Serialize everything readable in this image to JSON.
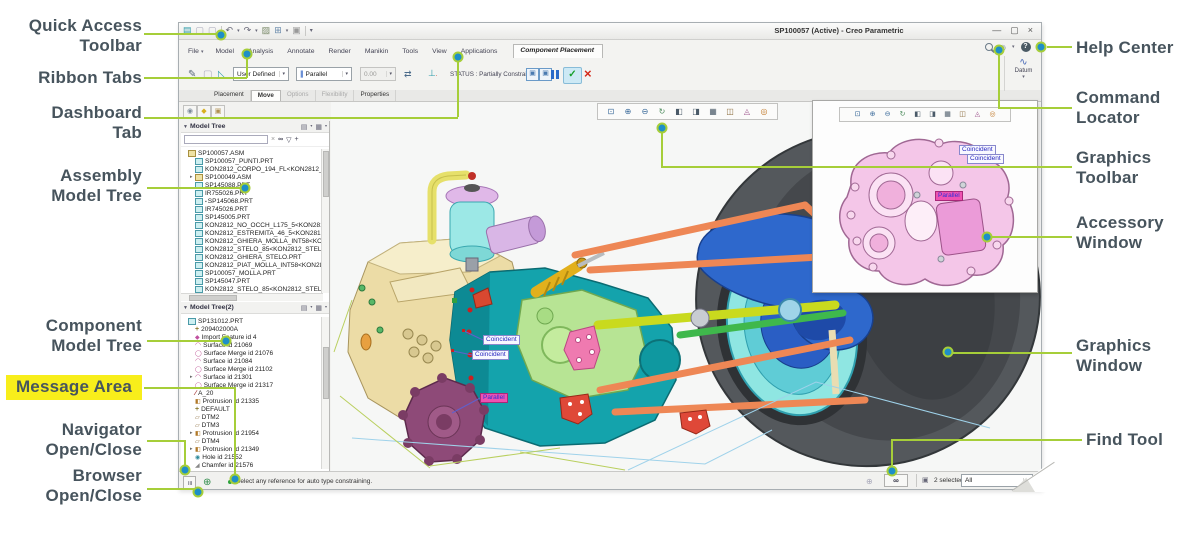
{
  "callouts": {
    "left": [
      {
        "label": "Quick Access\nToolbar"
      },
      {
        "label": "Ribbon Tabs"
      },
      {
        "label": "Dashboard\nTab"
      },
      {
        "label": "Assembly\nModel Tree"
      },
      {
        "label": "Component\nModel Tree"
      },
      {
        "label": "Message Area"
      },
      {
        "label": "Navigator\nOpen/Close"
      },
      {
        "label": "Browser\nOpen/Close"
      }
    ],
    "right": [
      {
        "label": "Help Center"
      },
      {
        "label": "Command\nLocator"
      },
      {
        "label": "Graphics\nToolbar"
      },
      {
        "label": "Accessory\nWindow"
      },
      {
        "label": "Graphics\nWindow"
      },
      {
        "label": "Find Tool"
      }
    ],
    "colors": {
      "line": "#a6ce39",
      "dot": "#1e8fc8",
      "text": "#47545d",
      "highlight": "#f8ee1b"
    }
  },
  "titlebar": {
    "title": "SP100057 (Active) - Creo Parametric"
  },
  "ribbon": {
    "tabs": [
      {
        "label": "File",
        "caret": "▾"
      },
      {
        "label": "Model"
      },
      {
        "label": "Analysis"
      },
      {
        "label": "Annotate"
      },
      {
        "label": "Render"
      },
      {
        "label": "Manikin"
      },
      {
        "label": "Tools"
      },
      {
        "label": "View"
      },
      {
        "label": "Applications"
      },
      {
        "label": "Component Placement",
        "state": "active"
      }
    ],
    "datum_group": {
      "label": "Datum"
    }
  },
  "dashboard": {
    "preset_value": "User Defined",
    "constraint_value": "Parallel",
    "offset_value": "0.00",
    "status_label": "STATUS : Partially Constrained",
    "tabs": [
      {
        "label": "Placement"
      },
      {
        "label": "Move",
        "state": "active"
      },
      {
        "label": "Options",
        "state": "disabled"
      },
      {
        "label": "Flexibility",
        "state": "disabled"
      },
      {
        "label": "Properties"
      }
    ]
  },
  "navigator": {
    "tree1": {
      "title": "Model Tree",
      "items": [
        {
          "glyph": "asm",
          "label": "SP100057.ASM"
        },
        {
          "glyph": "part",
          "label": "SP100057_PUNTI.PRT",
          "indent": 1
        },
        {
          "glyph": "part",
          "label": "KON2812_CORPO_194_FL<KON2812_COR",
          "indent": 1
        },
        {
          "glyph": "asm",
          "label": "SP100049.ASM",
          "indent": 1,
          "expander": "▸"
        },
        {
          "glyph": "part",
          "label": "SP145088.PRT",
          "indent": 1
        },
        {
          "glyph": "part",
          "label": "IR755026.PRT",
          "indent": 1
        },
        {
          "glyph": "part",
          "label": "SP145068.PRT",
          "indent": 1,
          "marker": true
        },
        {
          "glyph": "part",
          "label": "IR745026.PRT",
          "indent": 1
        },
        {
          "glyph": "part",
          "label": "SP145005.PRT",
          "indent": 1
        },
        {
          "glyph": "part",
          "label": "KON2812_NO_OCCH_L175_5<KON2812_C",
          "indent": 1
        },
        {
          "glyph": "part",
          "label": "KON2812_ESTREMITA_46_5<KON2812_ES",
          "indent": 1
        },
        {
          "glyph": "part",
          "label": "KON2812_GHIERA_MOLLA_INT58<KON281",
          "indent": 1
        },
        {
          "glyph": "part",
          "label": "KON2812_STELO_85<KON2812_STELO<P",
          "indent": 1
        },
        {
          "glyph": "part",
          "label": "KON2812_GHIERA_STELO.PRT",
          "indent": 1
        },
        {
          "glyph": "part",
          "label": "KON2812_PIAT_MOLLA_INT58<KON2812_P",
          "indent": 1
        },
        {
          "glyph": "part",
          "label": "SP100057_MOLLA.PRT",
          "indent": 1
        },
        {
          "glyph": "part",
          "label": "SP145047.PRT",
          "indent": 1
        },
        {
          "glyph": "part",
          "label": "KON2812_STELO_85<KON2812_STELO> P",
          "indent": 1
        }
      ]
    },
    "tree2": {
      "title": "Model Tree(2)",
      "items": [
        {
          "glyph": "part",
          "label": "SP131012.PRT"
        },
        {
          "glyph": "csys",
          "label": "209402000A",
          "indent": 1
        },
        {
          "glyph": "import",
          "label": "Import Feature id 4",
          "indent": 1
        },
        {
          "glyph": "surface",
          "label": "Surface id 21069",
          "indent": 1
        },
        {
          "glyph": "merge",
          "label": "Surface Merge id 21076",
          "indent": 1
        },
        {
          "glyph": "surface",
          "label": "Surface id 21084",
          "indent": 1
        },
        {
          "glyph": "merge",
          "label": "Surface Merge id 21102",
          "indent": 1
        },
        {
          "glyph": "surface",
          "label": "Surface id 21301",
          "indent": 1,
          "expander": "▸"
        },
        {
          "glyph": "merge",
          "label": "Surface Merge id 21317",
          "indent": 1
        },
        {
          "glyph": "axis",
          "label": "A_20",
          "indent": 1
        },
        {
          "glyph": "protrusion",
          "label": "Protrusion id 21335",
          "indent": 1
        },
        {
          "glyph": "csys",
          "label": "DEFAULT",
          "indent": 1
        },
        {
          "glyph": "datum",
          "label": "DTM2",
          "indent": 1
        },
        {
          "glyph": "datum",
          "label": "DTM3",
          "indent": 1
        },
        {
          "glyph": "protrusion",
          "label": "Protrusion id 21954",
          "indent": 1,
          "expander": "▸"
        },
        {
          "glyph": "datum",
          "label": "DTM4",
          "indent": 1
        },
        {
          "glyph": "protrusion",
          "label": "Protrusion id 21349",
          "indent": 1,
          "expander": "▸"
        },
        {
          "glyph": "hole",
          "label": "Hole id 21552",
          "indent": 1
        },
        {
          "glyph": "chamfer",
          "label": "Chamfer id 21576",
          "indent": 1
        }
      ]
    }
  },
  "graphics": {
    "toolbar_icons": [
      {
        "name": "zoom-region-icon",
        "glyph": "zoom-region"
      },
      {
        "name": "zoom-in-icon",
        "glyph": "zoom-in"
      },
      {
        "name": "zoom-out-icon",
        "glyph": "zoom-out"
      },
      {
        "name": "repaint-icon",
        "glyph": "repaint"
      },
      {
        "name": "display-style-icon",
        "glyph": "display-style"
      },
      {
        "name": "saved-orientations-icon",
        "glyph": "saved-orientations"
      },
      {
        "name": "view-manager-icon",
        "glyph": "view-manager"
      },
      {
        "name": "datum-display-icon",
        "glyph": "datum-display"
      },
      {
        "name": "annotation-display-icon",
        "glyph": "annotation-display"
      },
      {
        "name": "spin-center-icon",
        "glyph": "spin-center"
      }
    ],
    "tags": [
      {
        "text": "Coincident",
        "style": "light"
      },
      {
        "text": "Coincident",
        "style": "light"
      },
      {
        "text": "Parallel",
        "style": "magenta"
      }
    ],
    "part_colors": {
      "tire": "#54585c",
      "rim": "#8fe6e2",
      "hub_carrier": "#2e68cc",
      "gear_case": "#14a3ac",
      "case_cover": "#b7e494",
      "tank": "#ecdca6",
      "reservoir": "#9ce8e6",
      "suspension_arms": "#ee8755",
      "driveshaft": "#c9da1e",
      "link_rod": "#3fb84c",
      "shock": "#e2b01c",
      "front_cover": "#8e4a78",
      "accessory_part": "#f3c3e6"
    }
  },
  "accessory_window": {
    "tags": [
      {
        "text": "Coincident",
        "style": "light"
      },
      {
        "text": "Coincident",
        "style": "light"
      },
      {
        "text": "Parallel",
        "style": "magenta"
      }
    ]
  },
  "statusbar": {
    "message": "Select any reference for auto type constraining.",
    "selected_count": "2 selected",
    "filter_value": "All"
  }
}
